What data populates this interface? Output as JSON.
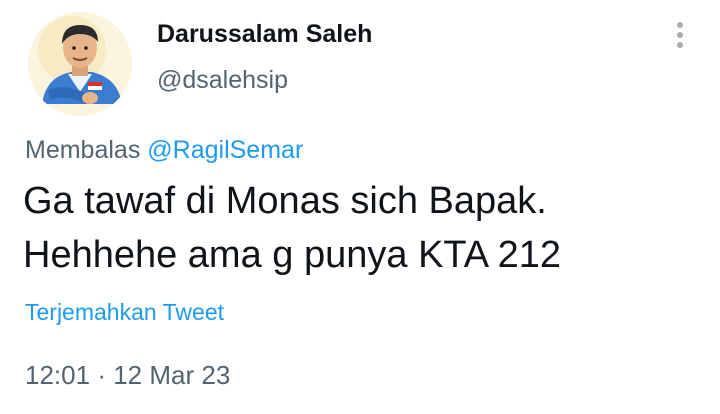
{
  "author": {
    "display_name": "Darussalam Saleh",
    "handle": "@dsalehsip",
    "avatar_icon": "illustrated-portrait-avatar"
  },
  "reply": {
    "prefix": "Membalas",
    "mention": "@RagilSemar"
  },
  "tweet": {
    "lines": [
      "Ga tawaf di Monas sich Bapak.",
      "Hehhehe ama g punya KTA 212"
    ]
  },
  "translate_label": "Terjemahkan Tweet",
  "timestamp": {
    "time": "12:01",
    "separator": "·",
    "date": "12 Mar 23"
  },
  "more_icon": "vertical-ellipsis-icon",
  "colors": {
    "text": "#0f1419",
    "secondary": "#536471",
    "link": "#1d9bf0",
    "background": "#ffffff"
  }
}
